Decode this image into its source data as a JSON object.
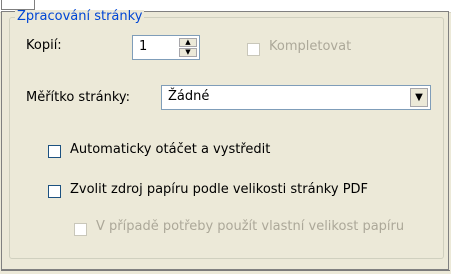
{
  "group": {
    "title": "Zpracování stránky",
    "copies": {
      "label": "Kopií:",
      "value": "1"
    },
    "collate": {
      "label": "Kompletovat",
      "checked": false,
      "enabled": false
    },
    "scale": {
      "label": "Měřítko stránky:",
      "selected": "Žádné"
    },
    "auto_rotate": {
      "label": "Automaticky otáčet a vystředit",
      "checked": false
    },
    "choose_paper_source": {
      "label": "Zvolit zdroj papíru podle velikosti stránky PDF",
      "checked": false
    },
    "custom_paper_size": {
      "label": "V případě potřeby použít vlastní velikost papíru",
      "checked": false,
      "enabled": false
    }
  },
  "icons": {
    "spin_up": "arrow-up-icon",
    "spin_down": "arrow-down-icon",
    "dropdown": "chevron-down-icon"
  },
  "colors": {
    "background": "#ece9d8",
    "legend": "#0046d5",
    "disabled_text": "#aca899",
    "field_border": "#7f9db9"
  }
}
